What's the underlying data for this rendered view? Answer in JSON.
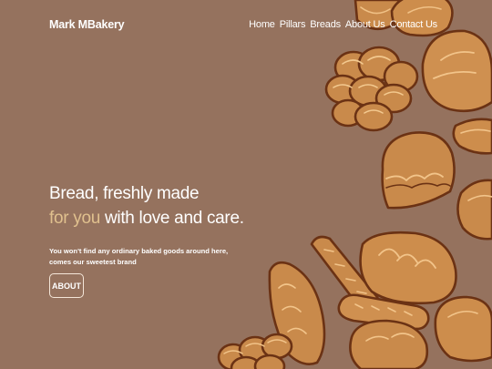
{
  "brand": "Mark MBakery",
  "nav": {
    "items": [
      "Home",
      "Pillars",
      "Breads",
      "About Us",
      "Contact Us"
    ]
  },
  "hero": {
    "line1": "Bread, freshly made",
    "line2_accent": "for you",
    "line2_rest": " with love and care.",
    "sub_line1": "You won't find any ordinary baked goods around here,",
    "sub_line2": "comes our sweetest brand",
    "button": "ABOUT"
  },
  "colors": {
    "background": "#95725e",
    "accent_text": "#e0c08e",
    "bread": "#c98a4b",
    "bread_outline": "#6b3214"
  },
  "illustration": {
    "icons": [
      "bread-braid-icon",
      "bread-bun-icon",
      "bread-loaf-icon",
      "baguette-icon",
      "bread-roll-icon"
    ]
  }
}
